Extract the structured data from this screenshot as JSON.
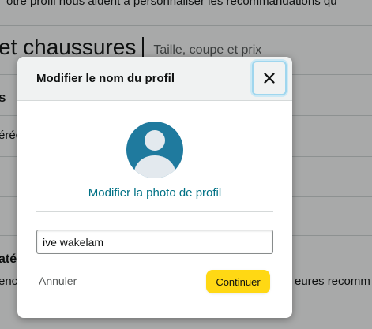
{
  "background": {
    "intro_text": "otre profil nous aident à personnaliser les recommandations qu",
    "section_title": "et chaussures",
    "section_subtitle": "Taille, coupe et prix",
    "fragments": [
      "s",
      "éréc",
      "até",
      "enc",
      "eures recomm"
    ]
  },
  "modal": {
    "title": "Modifier le nom du profil",
    "close_icon": "close-icon",
    "avatar_icon": "user-avatar-icon",
    "change_photo_label": "Modifier la photo de profil",
    "name_input": {
      "value": "ive wakelam",
      "placeholder": ""
    },
    "cancel_label": "Annuler",
    "continue_label": "Continuer"
  },
  "colors": {
    "link": "#007185",
    "primary_button": "#ffd814",
    "avatar_bg": "#1f7a9e",
    "header_bg": "#f0f2f2",
    "focus_ring": "#9fd6ee"
  }
}
